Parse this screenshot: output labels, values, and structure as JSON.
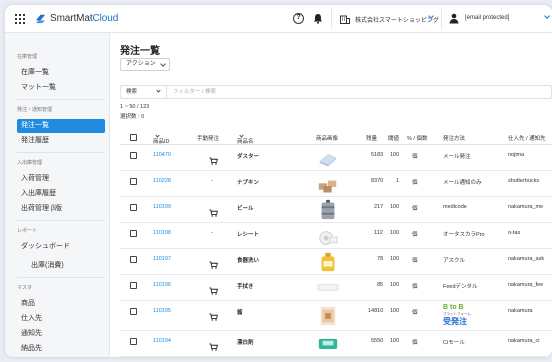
{
  "app": {
    "logo_prefix": "SmartMat",
    "logo_suffix": "Cloud",
    "brand_color": "#1f6fd1",
    "accent_color": "#1f8ae0",
    "company": "株式会社スマートショッピング",
    "user_email": "[email protected]"
  },
  "sidebar": {
    "sections": [
      {
        "title": "在庫管理",
        "items": [
          "在庫一覧",
          "マット一覧"
        ]
      },
      {
        "title": "発注・通知管理",
        "items": [
          "発注一覧",
          "発注履歴"
        ]
      },
      {
        "title": "入出庫管理",
        "items": [
          "入荷管理",
          "入出庫履歴",
          "出荷管理 β版"
        ]
      },
      {
        "title": "レポート",
        "items": [
          "ダッシュボード",
          "出庫(消費)"
        ]
      },
      {
        "title": "マスタ",
        "items": [
          "商品",
          "仕入先",
          "通知先",
          "納品先"
        ]
      }
    ],
    "active_item": "発注一覧"
  },
  "main": {
    "title": "発注一覧",
    "action_label": "アクション",
    "filter_field": "検索",
    "filter_placeholder": "フィルター / 検索",
    "count_text": "1 ~ 50 / 123",
    "selected_text": "選択数 : 0"
  },
  "table": {
    "headers": [
      "商品ID",
      "手動発注",
      "商品名",
      "商品画像",
      "残量",
      "閾値",
      "% / 個数",
      "発注方法",
      "仕入先 / 通知先"
    ],
    "rows": [
      {
        "id": "110470",
        "manual": "cart",
        "name": "ダスター",
        "image": "duster",
        "remaining": "5183",
        "threshold": "100",
        "unit": "個",
        "method": "メール発注",
        "supplier": "nojima"
      },
      {
        "id": "110228",
        "manual": "-",
        "name": "ナプキン",
        "image": "napkin",
        "remaining": "8370",
        "threshold": "1",
        "unit": "個",
        "method": "メール通知のみ",
        "supplier": "shutterbucks"
      },
      {
        "id": "110199",
        "manual": "cart",
        "name": "ビール",
        "image": "beer",
        "remaining": "217",
        "threshold": "100",
        "unit": "個",
        "method": "medicode",
        "supplier": "nakamura_me"
      },
      {
        "id": "110198",
        "manual": "-",
        "name": "レシート",
        "image": "receipt",
        "remaining": "112",
        "threshold": "100",
        "unit": "個",
        "method": "オータスカラPro",
        "supplier": "o-tas"
      },
      {
        "id": "110197",
        "manual": "cart",
        "name": "食器洗い",
        "image": "detergent",
        "remaining": "78",
        "threshold": "100",
        "unit": "個",
        "method": "アスクル",
        "supplier": "nakamura_ask"
      },
      {
        "id": "110196",
        "manual": "cart",
        "name": "手拭き",
        "image": "towel",
        "remaining": "85",
        "threshold": "100",
        "unit": "個",
        "method": "Feedデンタル",
        "supplier": "nakamura_fee"
      },
      {
        "id": "110195",
        "manual": "cart",
        "name": "酱",
        "image": "sauce",
        "remaining": "14810",
        "threshold": "100",
        "unit": "個",
        "method": "BtoBプラットフォーム 受発注",
        "supplier": "nakamura"
      },
      {
        "id": "110194",
        "manual": "cart",
        "name": "漂白剤",
        "image": "bleach",
        "remaining": "5550",
        "threshold": "100",
        "unit": "個",
        "method": "Ciモール",
        "supplier": "nakamura_ci"
      }
    ]
  },
  "bob_logo": {
    "line1": "B to B",
    "line2": "プラットフォーム",
    "line3": "受発注"
  }
}
